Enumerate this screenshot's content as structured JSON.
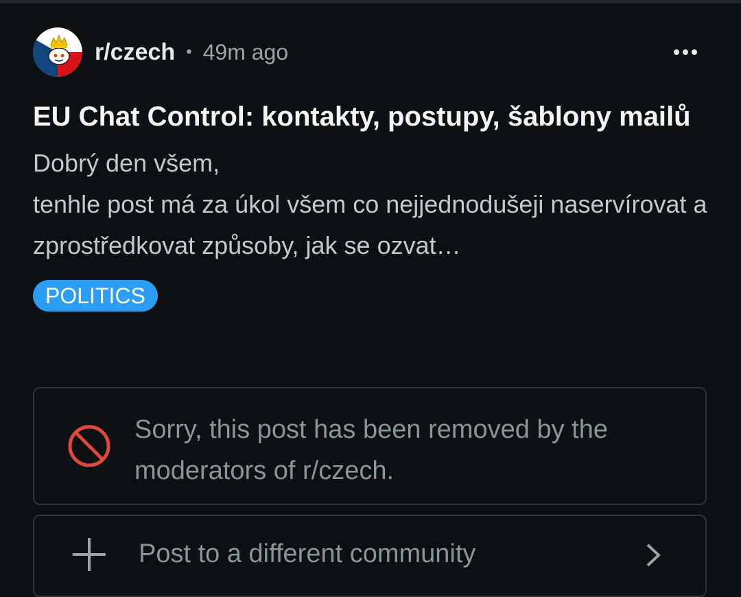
{
  "post": {
    "subreddit": "r/czech",
    "separator": "•",
    "time_ago": "49m ago",
    "title": "EU Chat Control: kontakty, postupy, šablony mailů",
    "body": "Dobrý den všem,\ntenhle post má za úkol všem co nejjednodušeji naservírovat a zprostředkovat způsoby, jak se ozvat…",
    "flair": "POLITICS",
    "flair_color": "#2b9ef3"
  },
  "removed_notice": {
    "text": "Sorry, this post has been removed by the moderators of r/czech.",
    "icon": "prohibited-icon",
    "icon_color": "#e0483e"
  },
  "crosspost": {
    "label": "Post to a different community",
    "icon": "plus-icon",
    "trailing_icon": "chevron-right-icon"
  },
  "colors": {
    "background": "#0e1113",
    "border": "#2f3437",
    "muted_text": "#8a959b"
  }
}
